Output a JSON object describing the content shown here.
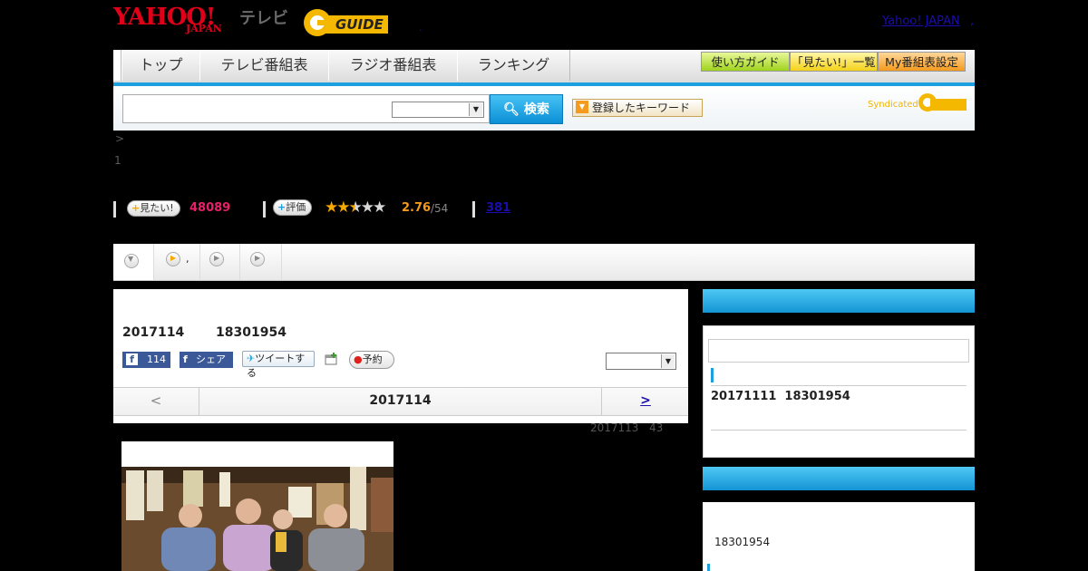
{
  "header": {
    "yahoo_logo": "YAHOO!",
    "yahoo_logo_sub": "JAPAN",
    "tv_label": "テレビ",
    "gguide_logo": "GUIDE",
    "dot": ".",
    "yahoo_japan_link": "Yahoo! JAPAN",
    "link_comma": ","
  },
  "nav": {
    "tabs": [
      "トップ",
      "テレビ番組表",
      "ラジオ番組表",
      "ランキング"
    ],
    "buttons": [
      "使い方ガイド",
      "「見たい!」一覧",
      "My番組表設定"
    ]
  },
  "search": {
    "input_value": "",
    "select_value": "",
    "button_label": "検索",
    "keyword_button": "登録したキーワード",
    "syndicated_text": "Syndicated"
  },
  "breadcrumb": {
    "separator": ">",
    "page_number": "1"
  },
  "stats": {
    "want_label": "見たい!",
    "want_count": "48089",
    "rate_label": "評価",
    "rating": "2.76",
    "rating_max": "/54",
    "rating_stars": 2.76,
    "reviews_link": "381"
  },
  "tabs": {
    "tab2_label": ","
  },
  "program": {
    "date": "2017114",
    "time": "18301954",
    "fb_count": "114",
    "fb_share": "シェア",
    "tweet": "ツイートする",
    "reserve": "予約",
    "select_value": "",
    "prev": "<",
    "nav_date": "2017114",
    "next": ">",
    "meta_date": "2017113",
    "meta_count": "43"
  },
  "sidebar": {
    "box1_item": "20171111  18301954",
    "box2_item": "18301954"
  },
  "colors": {
    "accent_blue": "#1da0e0",
    "yahoo_red": "#e0001a",
    "gguide_yellow": "#f5b800",
    "pink": "#e8206a"
  }
}
